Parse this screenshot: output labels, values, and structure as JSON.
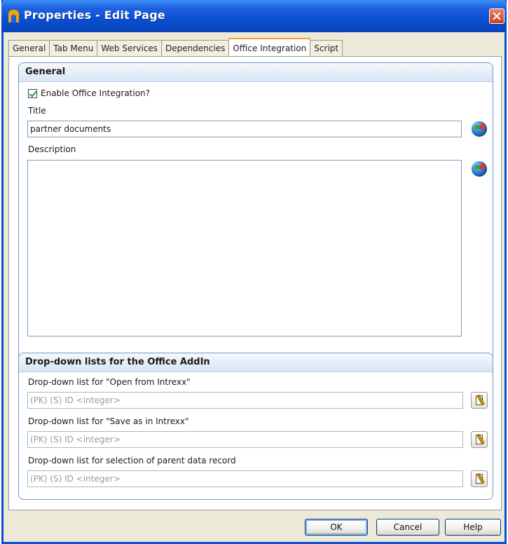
{
  "window": {
    "title": "Properties - Edit Page"
  },
  "tabs": [
    {
      "label": "General",
      "active": false
    },
    {
      "label": "Tab Menu",
      "active": false
    },
    {
      "label": "Web Services",
      "active": false
    },
    {
      "label": "Dependencies",
      "active": false
    },
    {
      "label": "Office Integration",
      "active": true
    },
    {
      "label": "Script",
      "active": false
    }
  ],
  "general": {
    "heading": "General",
    "enable_checkbox": {
      "label": "Enable Office Integration?",
      "checked": true
    },
    "title_label": "Title",
    "title_value": "partner documents",
    "description_label": "Description",
    "description_value": ""
  },
  "dropdowns": {
    "heading": "Drop-down lists for the Office AddIn",
    "open_label": "Drop-down list for \"Open from Intrexx\"",
    "open_value": "(PK) (S) ID <integer>",
    "save_label": "Drop-down list for \"Save as in Intrexx\"",
    "save_value": "(PK) (S) ID <integer>",
    "parent_label": "Drop-down list for selection of parent data record",
    "parent_value": "(PK) (S) ID <integer>"
  },
  "buttons": {
    "ok": "OK",
    "cancel": "Cancel",
    "help": "Help"
  },
  "icons": {
    "app": "intrexx-app-icon",
    "close": "close-icon",
    "language": "globe-language-icon",
    "picker": "edit-selection-icon"
  },
  "colors": {
    "titlebar": "#0a4fd1",
    "dialog_bg": "#ece9d8",
    "group_border": "#6f98cc",
    "active_tab_accent": "#f0a030"
  }
}
